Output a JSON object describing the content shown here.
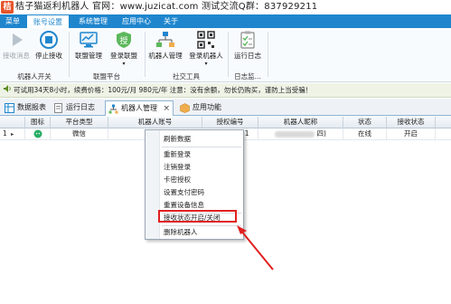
{
  "titlebar": {
    "icon_text": "桔",
    "text": "桔子猫返利机器人    官网：www.juzicat.com    测试交流Q群：837929211"
  },
  "menubar": {
    "tabs": [
      {
        "label": "菜单",
        "active": false
      },
      {
        "label": "账号设置",
        "active": true
      },
      {
        "label": "系统管理",
        "active": false
      },
      {
        "label": "应用中心",
        "active": false
      },
      {
        "label": "关于",
        "active": false
      }
    ]
  },
  "ribbon": {
    "buttons": {
      "receive_msg": "接收消息",
      "stop_receive": "停止接收",
      "alliance_mgmt": "联盟管理",
      "login_alliance": "登录联盟",
      "robot_mgmt": "机器人管理",
      "login_robot": "登录机器人",
      "run_log": "运行日志"
    },
    "groups": {
      "robot_switch": "机器人开关",
      "alliance_platform": "联盟平台",
      "social_tools": "社交工具",
      "log_monitor": "日志监..."
    }
  },
  "notice": {
    "text": "可试用34天8小时，续费价格：100元/月 980元/年  注意：没有余额，勿长仍购买，谨防上当受骗！"
  },
  "doc_tabs": [
    {
      "label": "数据报表",
      "active": false
    },
    {
      "label": "运行日志",
      "active": false
    },
    {
      "label": "机器人管理",
      "active": true,
      "close": "×"
    },
    {
      "label": "应用功能",
      "active": false
    }
  ],
  "grid": {
    "columns": [
      "图标",
      "平台类型",
      "机器人账号",
      "授权编号",
      "机器人昵称",
      "状态",
      "接收状态"
    ],
    "rows": [
      {
        "index": "1",
        "marker": "▸",
        "platform": "微信",
        "account": "",
        "auth_no": "21",
        "nickname": "",
        "nickname_suffix": "四)",
        "status": "在线",
        "receive_status": "开启"
      }
    ]
  },
  "context_menu": {
    "items": [
      {
        "label": "刷新数据"
      },
      {
        "label": "重新登录"
      },
      {
        "label": "注销登录"
      },
      {
        "label": "卡密授权"
      },
      {
        "label": "设置支付密码"
      },
      {
        "label": "重置设备信息"
      },
      {
        "label": "接收状态开启/关闭"
      },
      {
        "label": "删除机器人"
      }
    ],
    "highlighted_index": 6,
    "highlight_color": "#e02020"
  },
  "colors": {
    "menubar_bg": "#1f86ce",
    "annotation_red": "#e02020"
  }
}
